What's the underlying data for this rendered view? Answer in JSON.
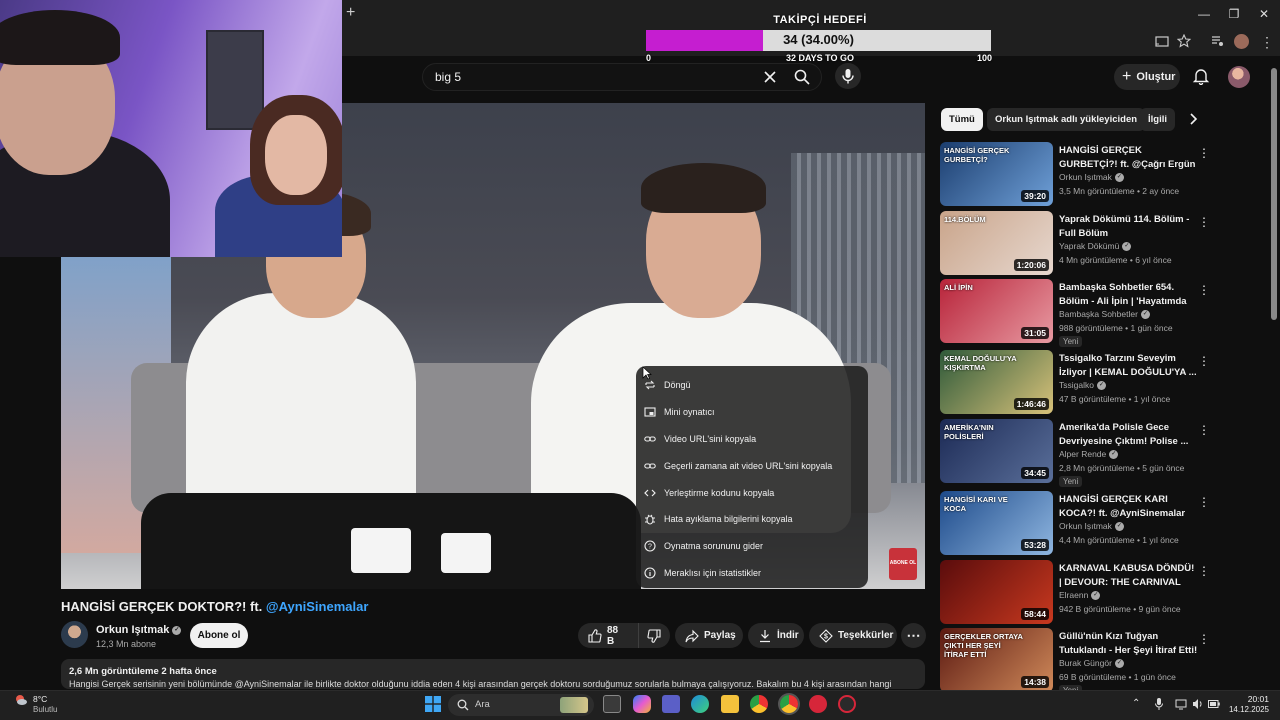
{
  "goal": {
    "title": "TAKİPÇİ HEDEFİ",
    "value_text": "34 (34.00%)",
    "progress": 0.34,
    "min": "0",
    "days": "32 DAYS TO GO",
    "max": "100",
    "fill_color": "#c51ed0"
  },
  "search": {
    "value": "big 5"
  },
  "header": {
    "create_label": "Oluştur"
  },
  "video": {
    "context_menu": [
      {
        "label": "Döngü",
        "icon": "loop-icon"
      },
      {
        "label": "Mini oynatıcı",
        "icon": "miniplayer-icon"
      },
      {
        "label": "Video URL'sini kopyala",
        "icon": "link-icon"
      },
      {
        "label": "Geçerli zamana ait video URL'sini kopyala",
        "icon": "link-icon"
      },
      {
        "label": "Yerleştirme kodunu kopyala",
        "icon": "code-icon"
      },
      {
        "label": "Hata ayıklama bilgilerini kopyala",
        "icon": "bug-icon"
      },
      {
        "label": "Oynatma sorununu gider",
        "icon": "help-icon"
      },
      {
        "label": "Meraklısı için istatistikler",
        "icon": "info-icon"
      }
    ],
    "subscribe_overlay": "ABONE OL",
    "title": "HANGİSİ GERÇEK DOKTOR?! ft.",
    "title_mention": "@AyniSinemalar",
    "channel": "Orkun Işıtmak",
    "subscribers": "12,3 Mn abone",
    "subscribe_label": "Abone ol",
    "likes": "88 B",
    "share_label": "Paylaş",
    "download_label": "İndir",
    "thanks_label": "Teşekkürler",
    "views_meta": "2,6 Mn görüntüleme  2 hafta önce",
    "description": "Hangisi Gerçek serisinin yeni bölümünde @AyniSinemalar ile birlikte doktor olduğunu iddia eden 4 kişi arasından gerçek doktoru sorduğumuz sorularla bulmaya çalışıyoruz. Bakalım bu 4 kişi arasından hangi"
  },
  "chips": [
    "Tümü",
    "Orkun Işıtmak adlı yükleyiciden",
    "İlgili"
  ],
  "recommendations": [
    {
      "title": "HANGİSİ GERÇEK GURBETÇİ?! ft. @Çağrı Ergün",
      "channel": "Orkun Işıtmak",
      "meta": "3,5 Mn görüntüleme • 2 ay önce",
      "duration": "39:20",
      "thumb_text": "HANGİSİ GERÇEK GURBETÇİ?",
      "badge": "",
      "colors": [
        "#1b3d6e",
        "#6fa0d8"
      ]
    },
    {
      "title": "Yaprak Dökümü 114. Bölüm - Full Bölüm",
      "channel": "Yaprak Dökümü",
      "meta": "4 Mn görüntüleme • 6 yıl önce",
      "duration": "1:20:06",
      "thumb_text": "114.BÖLÜM",
      "badge": "",
      "colors": [
        "#c9a48a",
        "#e7d8cf"
      ]
    },
    {
      "title": "Bambaşka Sohbetler 654. Bölüm - Ali İpin | 'Hayatımda H...",
      "channel": "Bambaşka Sohbetler",
      "meta": "988 görüntüleme • 1 gün önce",
      "duration": "31:05",
      "thumb_text": "ALİ İPİN",
      "badge": "Yeni",
      "colors": [
        "#b8243a",
        "#e89aa2"
      ]
    },
    {
      "title": "Tssigalko Tarzını Seveyim İzliyor | KEMAL DOĞULU'YA ...",
      "channel": "Tssigalko",
      "meta": "47 B görüntüleme • 1 yıl önce",
      "duration": "1:46:46",
      "thumb_text": "KEMAL DOĞULU'YA KIŞKIRTMA",
      "badge": "",
      "colors": [
        "#2f5a3a",
        "#d8c27a"
      ]
    },
    {
      "title": "Amerika'da Polisle Gece Devriyesine Çıktım! Polise ...",
      "channel": "Alper Rende",
      "meta": "2,8 Mn görüntüleme • 5 gün önce",
      "duration": "34:45",
      "thumb_text": "AMERİKA'NIN POLİSLERİ",
      "badge": "Yeni",
      "colors": [
        "#1c2a55",
        "#5a6f9a"
      ]
    },
    {
      "title": "HANGİSİ GERÇEK KARI KOCA?! ft. @AyniSinemalar",
      "channel": "Orkun Işıtmak",
      "meta": "4,4 Mn görüntüleme • 1 yıl önce",
      "duration": "53:28",
      "thumb_text": "HANGİSİ KARI VE KOCA",
      "badge": "",
      "colors": [
        "#1d4a8a",
        "#8fb6e0"
      ]
    },
    {
      "title": "KARNAVAL KABUSA DÖNDÜ! | DEVOUR: THE CARNIVAL",
      "channel": "Elraenn",
      "meta": "942 B görüntüleme • 9 gün önce",
      "duration": "58:44",
      "thumb_text": "",
      "badge": "",
      "colors": [
        "#5a0c0c",
        "#c8391f"
      ]
    },
    {
      "title": "Güllü'nün Kızı Tuğyan Tutuklandı - Her Şeyi İtiraf Etti!",
      "channel": "Burak Güngör",
      "meta": "69 B görüntüleme • 1 gün önce",
      "duration": "14:38",
      "thumb_text": "GERÇEKLER ORTAYA ÇIKTI HER ŞEYİ İTİRAF ETTİ",
      "badge": "Yeni",
      "colors": [
        "#5c1a12",
        "#d08a5a"
      ]
    }
  ],
  "taskbar": {
    "weather_temp": "8°C",
    "weather_desc": "Bulutlu",
    "search_placeholder": "Ara",
    "time": "20:01",
    "date": "14.12.2025"
  }
}
